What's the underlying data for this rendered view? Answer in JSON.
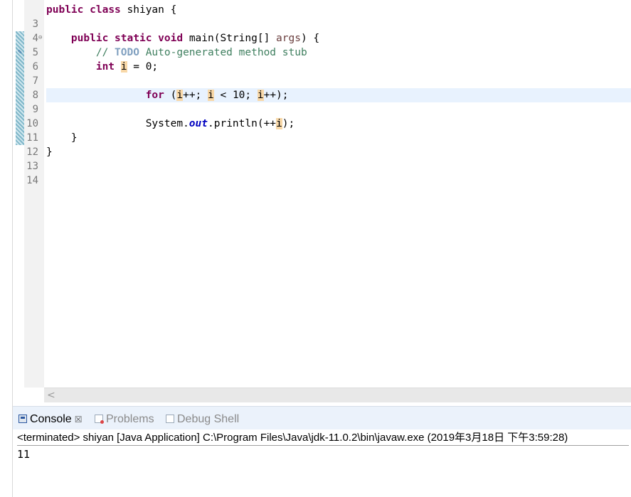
{
  "editor": {
    "lines": [
      {
        "n": "3"
      },
      {
        "n": "4"
      },
      {
        "n": "5"
      },
      {
        "n": "6"
      },
      {
        "n": "7"
      },
      {
        "n": "8"
      },
      {
        "n": "9"
      },
      {
        "n": "10"
      },
      {
        "n": "11"
      },
      {
        "n": "12"
      },
      {
        "n": "13"
      },
      {
        "n": "14"
      }
    ],
    "fold_marker": "⊖",
    "tokens": {
      "l3_public": "public",
      "l3_class": "class",
      "l3_name": " shiyan {",
      "l5_public": "public",
      "l5_static": "static",
      "l5_void": "void",
      "l5_main": " main(String[] ",
      "l5_args": "args",
      "l5_end": ") {",
      "l6_comment_start": "// ",
      "l6_todo": "TODO",
      "l6_comment_rest": " Auto-generated method stub",
      "l7_int": "int",
      "l7_var": "i",
      "l7_rest": " = 0;",
      "l9_for": "for",
      "l9_open": " (",
      "l9_var1": "i",
      "l9_mid1": "++; ",
      "l9_var2": "i",
      "l9_mid2": " < 10; ",
      "l9_var3": "i",
      "l9_end": "++);",
      "l11_sys": "System.",
      "l11_out": "out",
      "l11_println": ".println(++",
      "l11_var": "i",
      "l11_end": ");",
      "l12_brace": "}",
      "l13_brace": "}"
    }
  },
  "scrollbar": {
    "left_arrow": "<"
  },
  "console": {
    "tabs": [
      {
        "label": "Console",
        "close": "☒"
      },
      {
        "label": "Problems"
      },
      {
        "label": "Debug Shell"
      }
    ],
    "terminated_line": "<terminated> shiyan [Java Application] C:\\Program Files\\Java\\jdk-11.0.2\\bin\\javaw.exe (2019年3月18日 下午3:59:28)",
    "output": "11"
  }
}
